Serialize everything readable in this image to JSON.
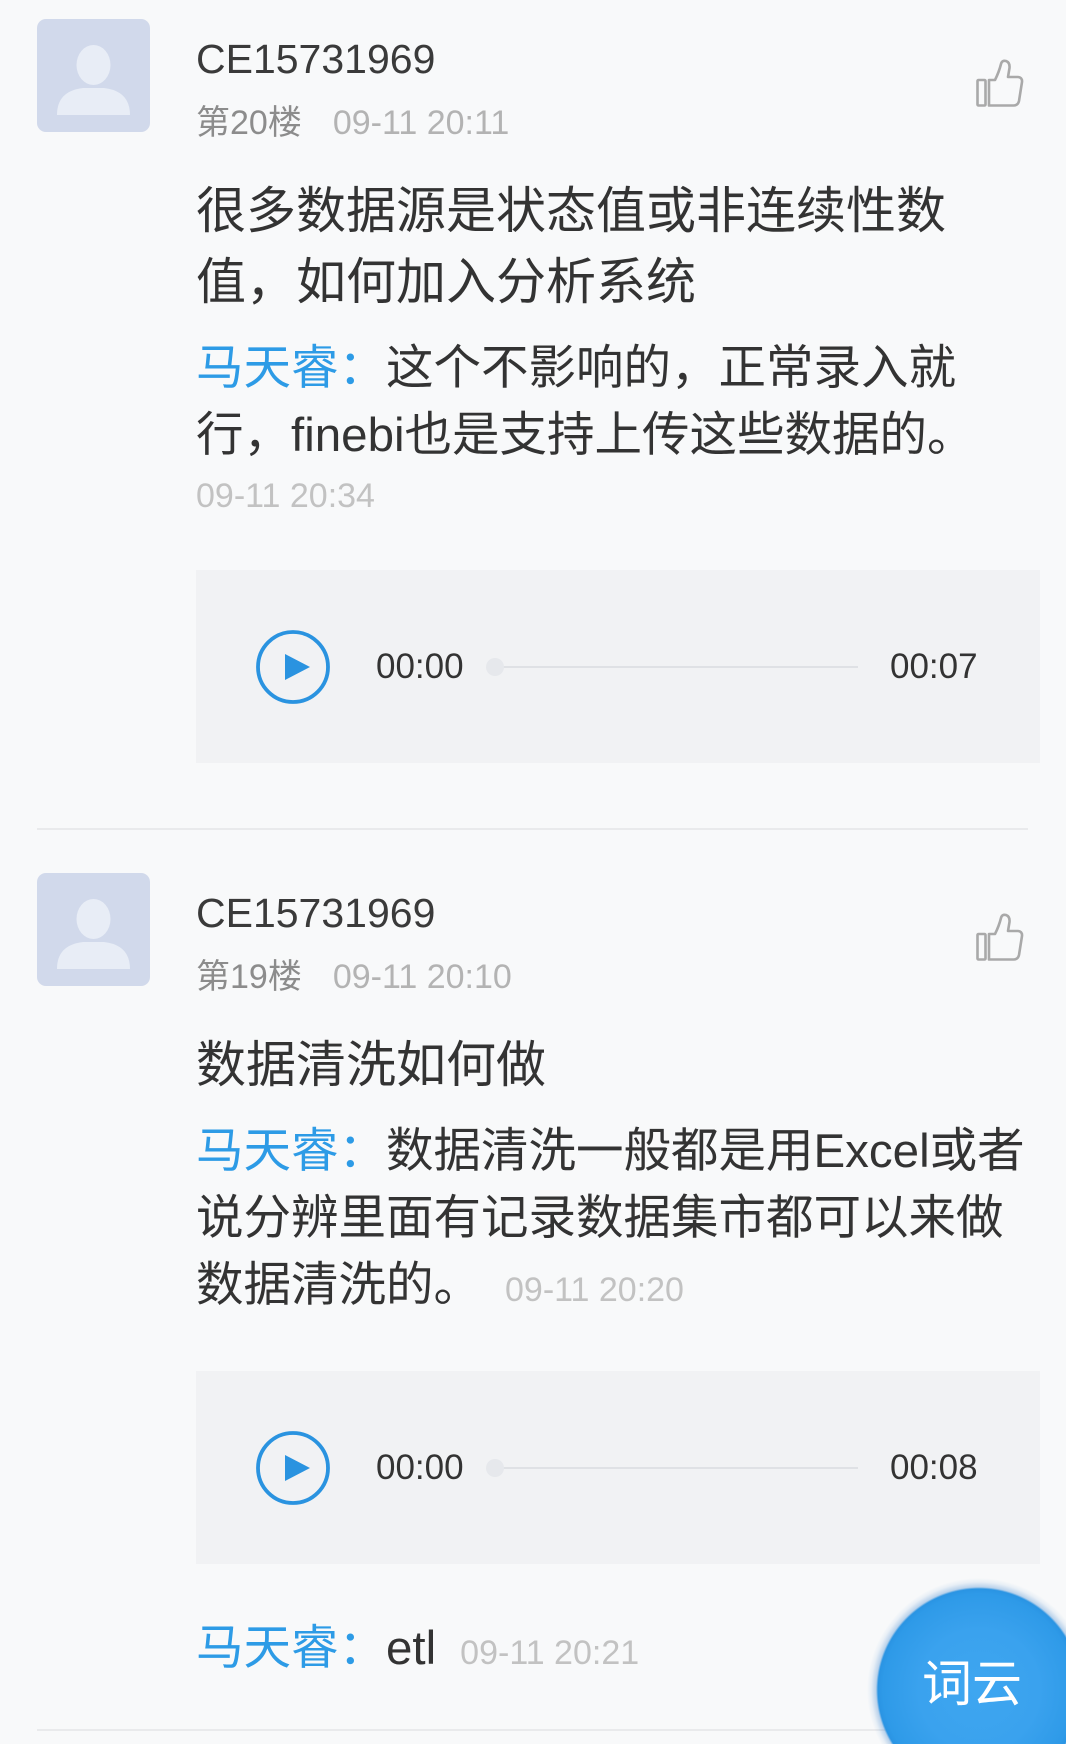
{
  "posts": [
    {
      "user": {
        "name": "CE15731969"
      },
      "floor": "第20楼",
      "time": "09-11 20:11",
      "question": "很多数据源是状态值或非连续性数值，如何加入分析系统",
      "reply": {
        "author": "马天睿：",
        "text": "这个不影响的，正常录入就行，finebi也是支持上传这些数据的。",
        "time": "09-11 20:34"
      },
      "audio": {
        "current": "00:00",
        "duration": "00:07",
        "progress": 0
      }
    },
    {
      "user": {
        "name": "CE15731969"
      },
      "floor": "第19楼",
      "time": "09-11 20:10",
      "question": "数据清洗如何做",
      "reply": {
        "author": "马天睿：",
        "text": "数据清洗一般都是用Excel或者说分辨里面有记录数据集市都可以来做数据清洗的。",
        "time": "09-11 20:20"
      },
      "audio": {
        "current": "00:00",
        "duration": "00:08",
        "progress": 0
      },
      "followup_reply": {
        "author": "马天睿：",
        "text": "etl",
        "time": "09-11 20:21"
      }
    }
  ],
  "fab": {
    "label": "词云"
  },
  "icons": {
    "avatar": "default-user-avatar-icon",
    "like": "thumbs-up-icon",
    "play": "play-circle-icon",
    "fab": "word-cloud-button"
  },
  "colors": {
    "accent": "#2d9be6",
    "play": "#2a93e0",
    "fab": "#2e9ae8",
    "text": "#333333",
    "floor_label": "#8c8c8c",
    "timestamp": "#b3b3b3",
    "reply_time": "#c2c2c2",
    "page_bg": "#f8f9fa",
    "audio_bg": "#f1f2f4",
    "avatar_bg": "#d1d9eb"
  }
}
